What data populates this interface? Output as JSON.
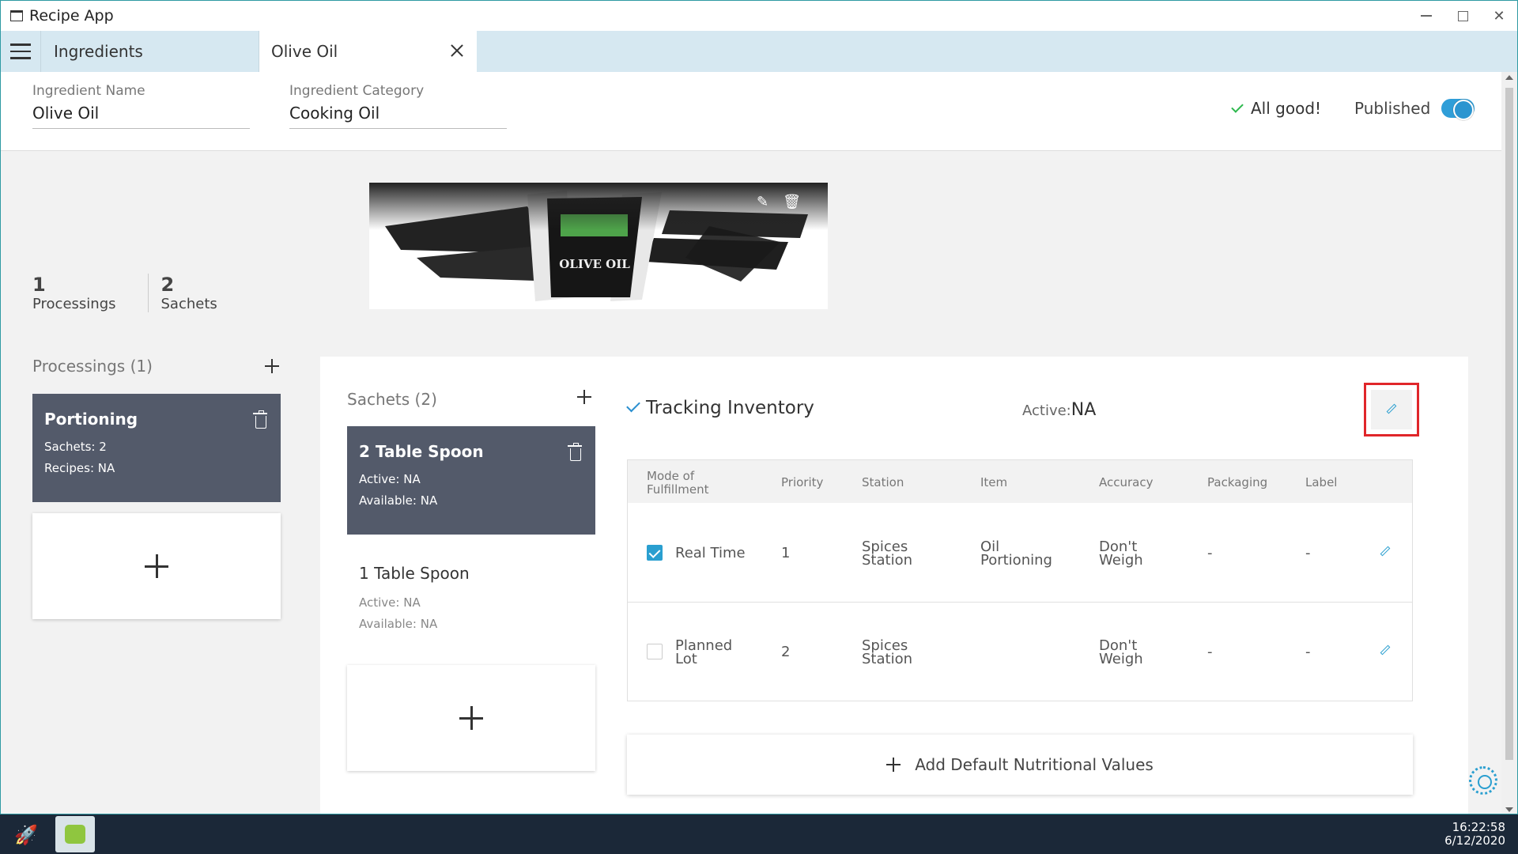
{
  "window": {
    "title": "Recipe App"
  },
  "tabs": [
    {
      "label": "Ingredients"
    },
    {
      "label": "Olive Oil"
    }
  ],
  "header": {
    "name_label": "Ingredient Name",
    "name_value": "Olive Oil",
    "category_label": "Ingredient Category",
    "category_value": "Cooking Oil",
    "status": "All good!",
    "published_label": "Published",
    "published": true
  },
  "stats": [
    {
      "count": "1",
      "label": "Processings"
    },
    {
      "count": "2",
      "label": "Sachets"
    }
  ],
  "image": {
    "brand_text": "OLIVE OIL"
  },
  "processings": {
    "title": "Processings (1)",
    "items": [
      {
        "name": "Portioning",
        "sachets": "Sachets: 2",
        "recipes": "Recipes: NA"
      }
    ]
  },
  "sachets": {
    "title": "Sachets (2)",
    "items": [
      {
        "name": "2 Table Spoon",
        "active": "Active: NA",
        "available": "Available: NA"
      },
      {
        "name": "1 Table Spoon",
        "active": "Active: NA",
        "available": "Available: NA"
      }
    ]
  },
  "tracking": {
    "title": "Tracking Inventory",
    "active_label": "Active:",
    "active_value": "NA"
  },
  "inventory_table": {
    "headers": [
      "Mode of Fulfillment",
      "Priority",
      "Station",
      "Item",
      "Accuracy",
      "Packaging",
      "Label"
    ],
    "rows": [
      {
        "checked": true,
        "mode": "Real Time",
        "priority": "1",
        "station": "Spices Station",
        "item": "Oil Portioning",
        "accuracy": "Don't Weigh",
        "packaging": "-",
        "label": "-"
      },
      {
        "checked": false,
        "mode": "Planned Lot",
        "priority": "2",
        "station": "Spices Station",
        "item": "",
        "accuracy": "Don't Weigh",
        "packaging": "-",
        "label": "-"
      }
    ]
  },
  "nutrition_button": "Add Default Nutritional Values",
  "taskbar": {
    "time": "16:22:58",
    "date": "6/12/2020"
  },
  "colors": {
    "accent": "#2a9fd0",
    "dark_card": "#535a6a",
    "highlight": "#e0262a",
    "ok_green": "#2db84d"
  }
}
